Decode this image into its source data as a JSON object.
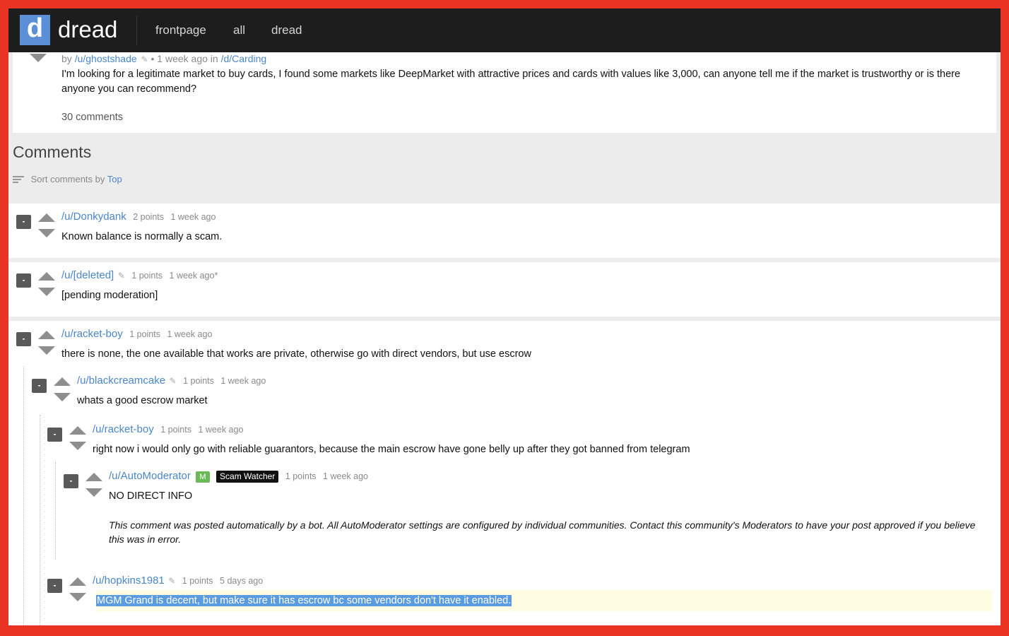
{
  "header": {
    "logo_letter": "d",
    "brand": "dread",
    "nav": [
      "frontpage",
      "all",
      "dread"
    ]
  },
  "post": {
    "meta_by": "by",
    "author": "/u/ghostshade",
    "meta_time": "• 1 week ago in",
    "sub": "/d/Carding",
    "body": "I'm looking for a legitimate market to buy cards, I found some markets like DeepMarket with attractive prices and cards with values like 3,000, can anyone tell me if the market is trustworthy or is there anyone you can recommend?",
    "comments_count": "30 comments"
  },
  "comments_section": {
    "title": "Comments",
    "sort_label": "Sort comments by",
    "sort_value": "Top"
  },
  "comments": [
    {
      "collapse": "-",
      "user": "/u/Donkydank",
      "points": "2 points",
      "time": "1 week ago",
      "body": "Known balance is normally a scam."
    },
    {
      "collapse": "-",
      "user": "/u/[deleted]",
      "points": "1 points",
      "time": "1 week ago*",
      "body": "[pending moderation]"
    },
    {
      "collapse": "-",
      "user": "/u/racket-boy",
      "points": "1 points",
      "time": "1 week ago",
      "body": "there is none, the one available that works are private, otherwise go with direct vendors, but use escrow"
    },
    {
      "collapse": "-",
      "user": "/u/blackcreamcake",
      "points": "1 points",
      "time": "1 week ago",
      "body": "whats a good escrow market"
    },
    {
      "collapse": "-",
      "user": "/u/racket-boy",
      "points": "1 points",
      "time": "1 week ago",
      "body": "right now i would only go with reliable guarantors, because the main escrow have gone belly up after they got banned from telegram"
    },
    {
      "collapse": "-",
      "user": "/u/AutoModerator",
      "badge_m": "M",
      "badge_role": "Scam Watcher",
      "points": "1 points",
      "time": "1 week ago",
      "body": "NO DIRECT INFO",
      "note": "This comment was posted automatically by a bot. All AutoModerator settings are configured by individual communities. Contact this community's Moderators to have your post approved if you believe this was in error."
    },
    {
      "collapse": "-",
      "user": "/u/hopkins1981",
      "points": "1 points",
      "time": "5 days ago",
      "body": "MGM Grand is decent, but make sure it has escrow bc some vendors don't have it enabled."
    }
  ],
  "colors": {
    "frame_border": "#ea3323",
    "topbar": "#1d1d1d",
    "logo": "#5b8fd6",
    "link": "#4a86c8",
    "mod_badge": "#6cb95a",
    "selection": "#5b9be0"
  }
}
